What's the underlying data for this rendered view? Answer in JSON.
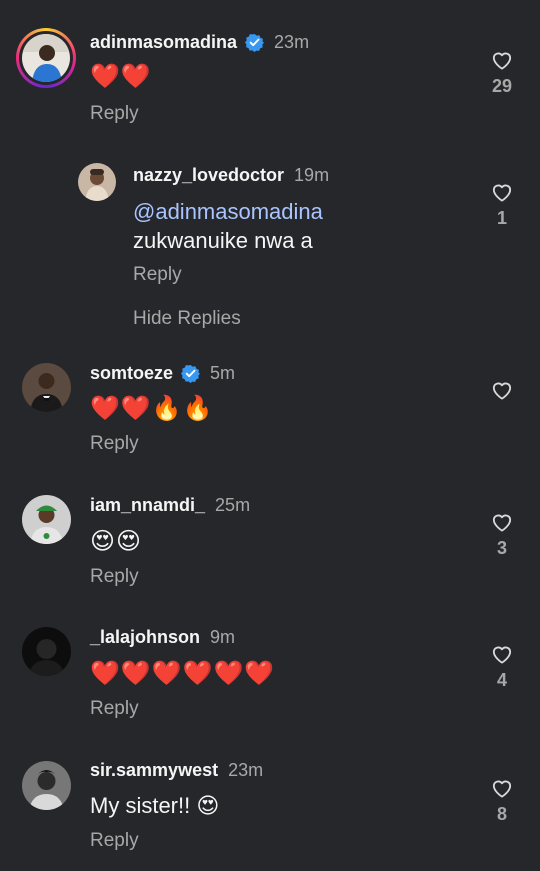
{
  "comments": [
    {
      "username": "adinmasomadina",
      "verified": true,
      "time": "23m",
      "text": "❤️❤️",
      "reply_label": "Reply",
      "likes": "29",
      "avatar_icon": "profile-photo-man-blue-shirt"
    },
    {
      "username": "nazzy_lovedoctor",
      "verified": false,
      "time": "19m",
      "mention": "@adinmasomadina",
      "text": "zukwanuike nwa a",
      "reply_label": "Reply",
      "likes": "1",
      "avatar_icon": "profile-photo-woman"
    },
    {
      "username": "somtoeze",
      "verified": true,
      "time": "5m",
      "text": "❤️❤️🔥🔥",
      "reply_label": "Reply",
      "likes": "",
      "avatar_icon": "profile-photo-man-tuxedo"
    },
    {
      "username": "iam_nnamdi_",
      "verified": false,
      "time": "25m",
      "text": "😍😍",
      "reply_label": "Reply",
      "likes": "3",
      "avatar_icon": "profile-photo-man-cap"
    },
    {
      "username": "_lalajohnson",
      "verified": false,
      "time": "9m",
      "text": "❤️❤️❤️❤️❤️❤️",
      "reply_label": "Reply",
      "likes": "4",
      "avatar_icon": "profile-photo-dark"
    },
    {
      "username": "sir.sammywest",
      "verified": false,
      "time": "23m",
      "text": "My sister!! 😍",
      "reply_label": "Reply",
      "likes": "8",
      "avatar_icon": "profile-photo-man-bw"
    }
  ],
  "hide_replies_label": "Hide Replies",
  "colors": {
    "background": "#26272b",
    "verified_badge": "#3897f0",
    "mention": "#a9c4ff",
    "secondary_text": "#a8a8a8"
  }
}
